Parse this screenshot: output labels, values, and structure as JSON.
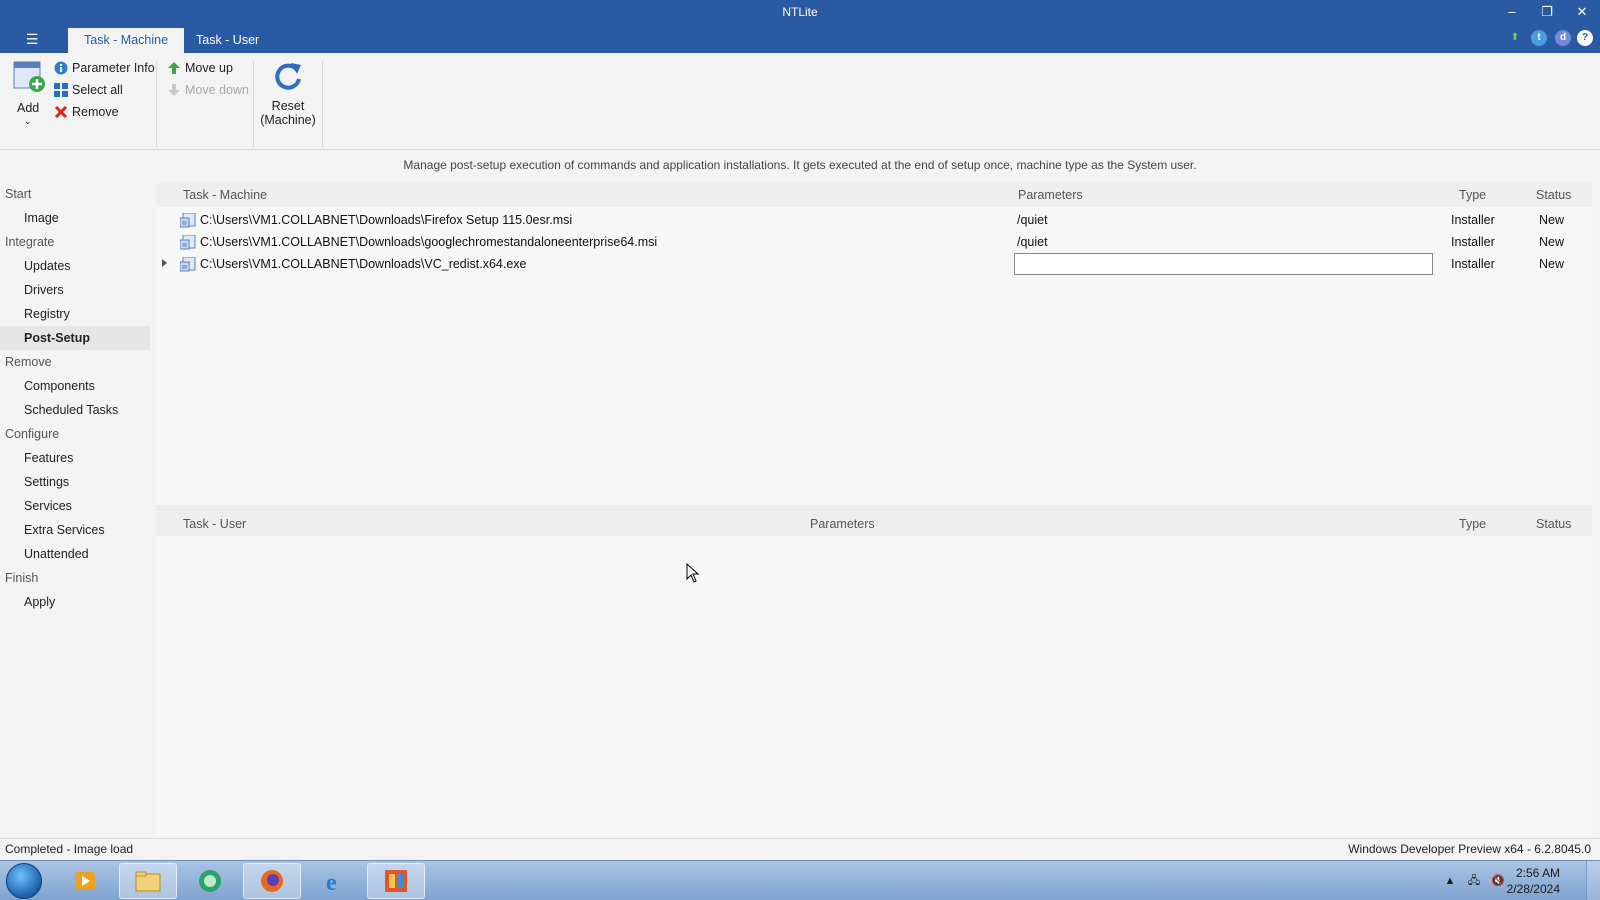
{
  "window": {
    "title": "NTLite",
    "minimize": "–",
    "restore": "❐",
    "close": "✕"
  },
  "tabs": [
    {
      "label": "Task - Machine",
      "active": true
    },
    {
      "label": "Task - User",
      "active": false
    }
  ],
  "header_icons": [
    "update-arrow-icon",
    "twitter-icon",
    "discord-icon",
    "help-icon"
  ],
  "ribbon": {
    "add_label": "Add",
    "parameter_info": "Parameter Info",
    "select_all": "Select all",
    "remove": "Remove",
    "move_up": "Move up",
    "move_down": "Move down",
    "reset_line1": "Reset",
    "reset_line2": "(Machine)"
  },
  "info_text": "Manage post-setup execution of commands and application installations. It gets executed at the end of setup once, machine type as the System user.",
  "sidebar": {
    "items": [
      {
        "label": "Start",
        "kind": "group"
      },
      {
        "label": "Image",
        "kind": "sub"
      },
      {
        "label": "Integrate",
        "kind": "group"
      },
      {
        "label": "Updates",
        "kind": "sub"
      },
      {
        "label": "Drivers",
        "kind": "sub"
      },
      {
        "label": "Registry",
        "kind": "sub"
      },
      {
        "label": "Post-Setup",
        "kind": "sub",
        "selected": true
      },
      {
        "label": "Remove",
        "kind": "group"
      },
      {
        "label": "Components",
        "kind": "sub"
      },
      {
        "label": "Scheduled Tasks",
        "kind": "sub"
      },
      {
        "label": "Configure",
        "kind": "group"
      },
      {
        "label": "Features",
        "kind": "sub"
      },
      {
        "label": "Settings",
        "kind": "sub"
      },
      {
        "label": "Services",
        "kind": "sub"
      },
      {
        "label": "Extra Services",
        "kind": "sub"
      },
      {
        "label": "Unattended",
        "kind": "sub"
      },
      {
        "label": "Finish",
        "kind": "group"
      },
      {
        "label": "Apply",
        "kind": "sub"
      }
    ]
  },
  "machine_table": {
    "headers": {
      "task": "Task - Machine",
      "parameters": "Parameters",
      "type": "Type",
      "status": "Status"
    },
    "rows": [
      {
        "path": "C:\\Users\\VM1.COLLABNET\\Downloads\\Firefox Setup 115.0esr.msi",
        "parameters": "/quiet",
        "type": "Installer",
        "status": "New"
      },
      {
        "path": "C:\\Users\\VM1.COLLABNET\\Downloads\\googlechromestandaloneenterprise64.msi",
        "parameters": "/quiet",
        "type": "Installer",
        "status": "New"
      },
      {
        "path": "C:\\Users\\VM1.COLLABNET\\Downloads\\VC_redist.x64.exe",
        "parameters": "",
        "type": "Installer",
        "status": "New"
      }
    ]
  },
  "user_table": {
    "headers": {
      "task": "Task - User",
      "parameters": "Parameters",
      "type": "Type",
      "status": "Status"
    }
  },
  "statusbar": {
    "left": "Completed - Image load",
    "right": "Windows Developer Preview x64 - 6.2.8045.0"
  },
  "taskbar": {
    "apps": [
      "media-player-icon",
      "file-explorer-icon",
      "green-globe-icon",
      "firefox-icon",
      "internet-explorer-icon",
      "ntlite-icon"
    ],
    "time": "2:56 AM",
    "date": "2/28/2024",
    "tray_expand": "▲"
  }
}
